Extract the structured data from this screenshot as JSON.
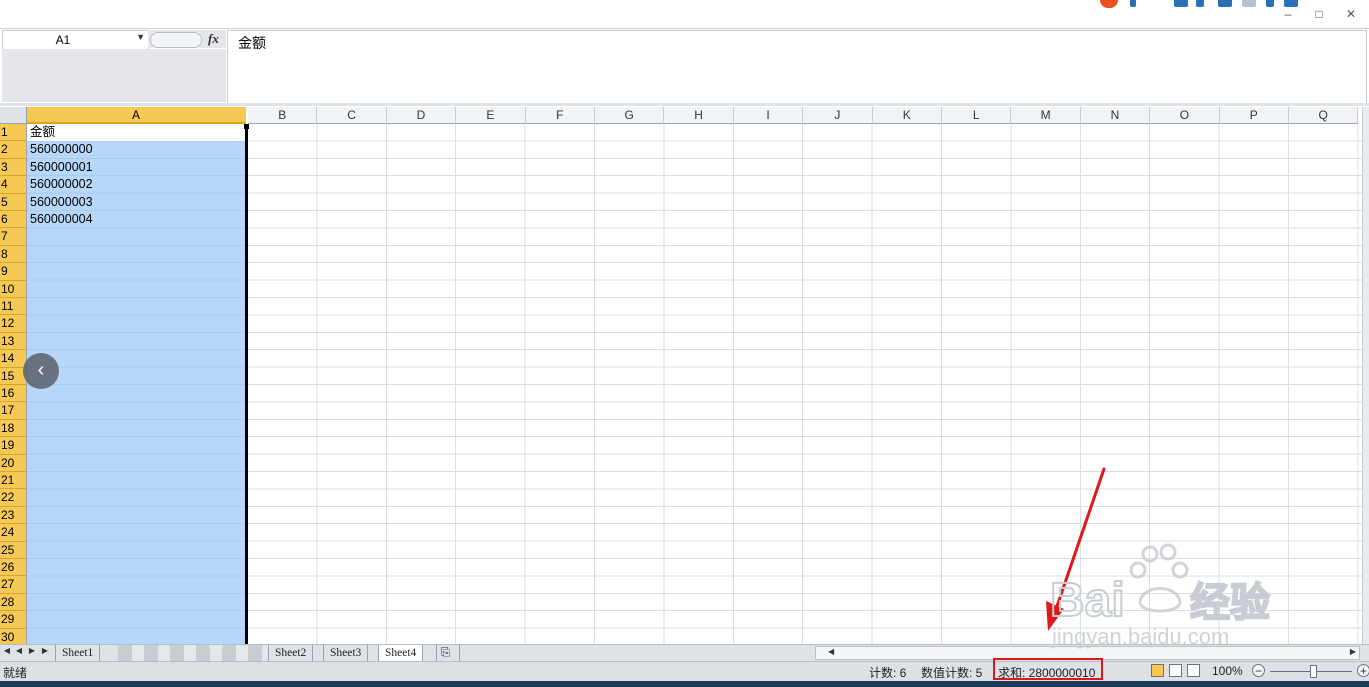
{
  "formula": {
    "name_box": "A1",
    "content": "金额"
  },
  "columns": [
    "A",
    "B",
    "C",
    "D",
    "E",
    "F",
    "G",
    "H",
    "I",
    "J",
    "K",
    "L",
    "M",
    "N",
    "O",
    "P",
    "Q"
  ],
  "rows": [
    "1",
    "2",
    "3",
    "4",
    "5",
    "6",
    "7",
    "8",
    "9",
    "10",
    "11",
    "12",
    "13",
    "14",
    "15",
    "16",
    "17",
    "18",
    "19",
    "20",
    "21",
    "22",
    "23",
    "24",
    "25",
    "26",
    "27",
    "28",
    "29",
    "30"
  ],
  "cells": [
    {
      "row": 1,
      "value": "金额"
    },
    {
      "row": 2,
      "value": "560000000"
    },
    {
      "row": 3,
      "value": "560000001"
    },
    {
      "row": 4,
      "value": "560000002"
    },
    {
      "row": 5,
      "value": "560000003"
    },
    {
      "row": 6,
      "value": "560000004"
    }
  ],
  "sheets": [
    "Sheet1",
    "Sheet2",
    "Sheet3",
    "Sheet4"
  ],
  "active_sheet": "Sheet4",
  "status": {
    "ready": "就绪",
    "count": "计数: 6",
    "numeric_count": "数值计数: 5",
    "sum": "求和: 2800000010",
    "zoom": "100%"
  },
  "watermark": {
    "brand": "Baidu经验",
    "url": "jingyan.baidu.com"
  },
  "colors": {
    "selection": "#b7d7f8",
    "header_selected": "#f6c955",
    "highlight_box": "#e01818"
  }
}
